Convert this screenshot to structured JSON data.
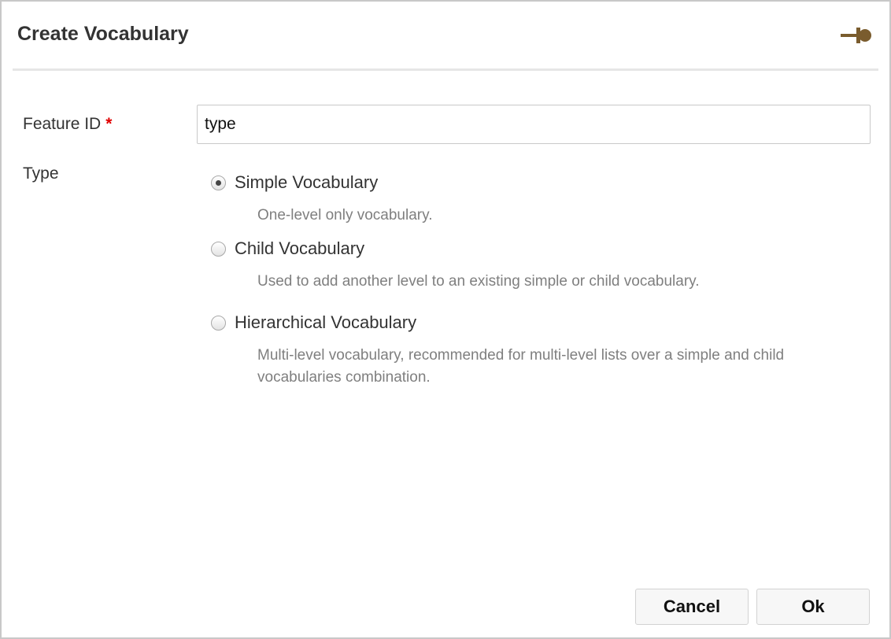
{
  "dialog": {
    "title": "Create Vocabulary",
    "pin_icon": "pin-icon",
    "accent_color": "#7a5c2e"
  },
  "form": {
    "feature_id": {
      "label": "Feature ID",
      "required_marker": "*",
      "value": "type"
    },
    "type": {
      "label": "Type",
      "selected": "Simple Vocabulary",
      "options": [
        {
          "label": "Simple Vocabulary",
          "description": "One-level only vocabulary.",
          "checked": true
        },
        {
          "label": "Child Vocabulary",
          "description": "Used to add another level to an existing simple or child vocabulary.",
          "checked": false
        },
        {
          "label": "Hierarchical Vocabulary",
          "description": "Multi-level vocabulary, recommended for multi-level lists over a simple and child vocabularies combination.",
          "checked": false
        }
      ]
    }
  },
  "buttons": {
    "cancel": "Cancel",
    "ok": "Ok"
  }
}
